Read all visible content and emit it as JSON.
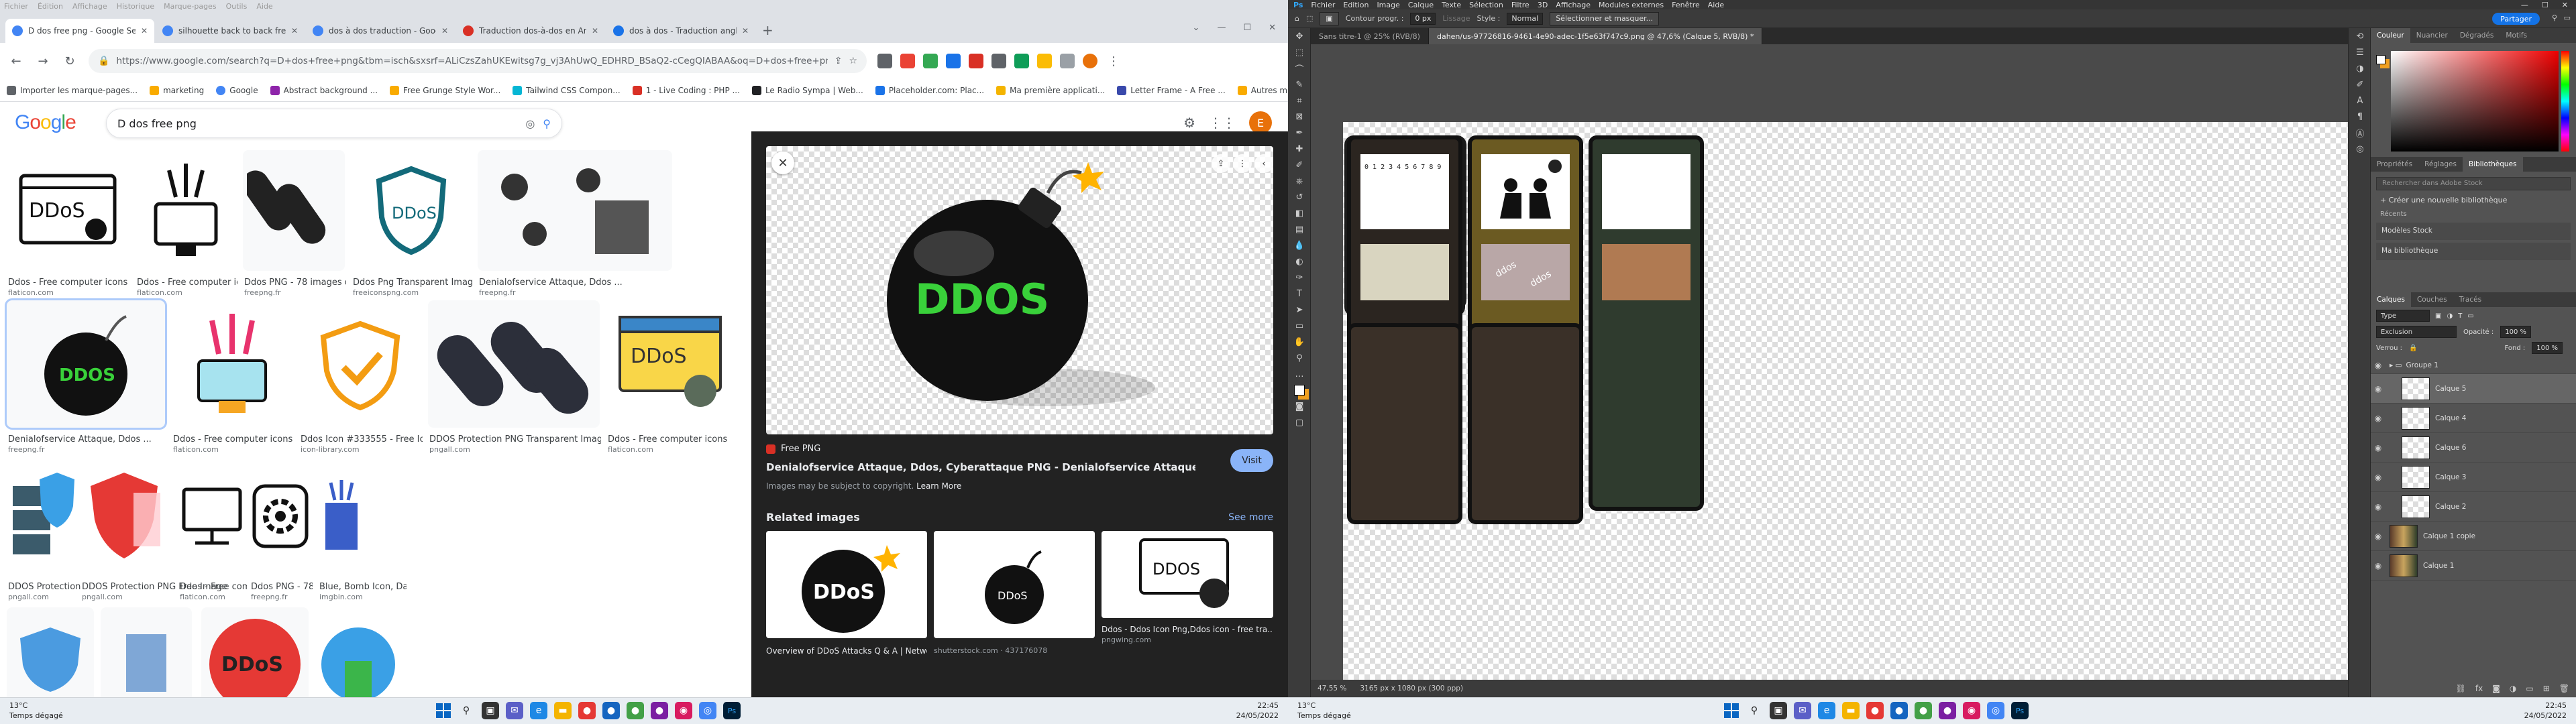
{
  "left": {
    "menu": [
      "Fichier",
      "Édition",
      "Affichage",
      "Historique",
      "Marque-pages",
      "Outils",
      "Aide"
    ],
    "tabs": [
      {
        "title": "D dos free png - Google Search",
        "color": "#4285f4",
        "active": true
      },
      {
        "title": "silhouette back to back free - G",
        "color": "#4285f4",
        "active": false
      },
      {
        "title": "dos à dos traduction - Google - G",
        "color": "#4285f4",
        "active": false
      },
      {
        "title": "Traduction dos-à-dos en Anglais",
        "color": "#d93025",
        "active": false
      },
      {
        "title": "dos à dos - Traduction anglaise",
        "color": "#1a73e8",
        "active": false
      }
    ],
    "new_tab": "+",
    "url": "https://www.google.com/search?q=D+dos+free+png&tbm=isch&sxsrf=ALiCzsZahUKEwitsg7g_vj3AhUwQ_EDHRD_BSaQ2-cCegQIABAA&oq=D+dos+free+png&gs_lcp=CgNpbWcQAzoECCMQJ",
    "bookmarks": [
      {
        "label": "Importer les marque-pages...",
        "color": "#5f6368"
      },
      {
        "label": "marketing",
        "color": "#f9ab00"
      },
      {
        "label": "Google",
        "color": "#4285f4"
      },
      {
        "label": "Abstract background ...",
        "color": "#8e24aa"
      },
      {
        "label": "Free Grunge Style Wor...",
        "color": "#f9ab00"
      },
      {
        "label": "Tailwind CSS Compon...",
        "color": "#06b6d4"
      },
      {
        "label": "1 - Live Coding : PHP ...",
        "color": "#d93025"
      },
      {
        "label": "Le Radio Sympa | Web...",
        "color": "#202124"
      },
      {
        "label": "Placeholder.com: Plac...",
        "color": "#1a73e8"
      },
      {
        "label": "Ma première applicati...",
        "color": "#f4b400"
      },
      {
        "label": "Letter Frame - A Free ...",
        "color": "#3949ab"
      }
    ],
    "bookmarks_more": "Autres marque-pages",
    "google_logo": [
      {
        "ch": "G",
        "color": "#4285f4"
      },
      {
        "ch": "o",
        "color": "#ea4335"
      },
      {
        "ch": "o",
        "color": "#fbbc05"
      },
      {
        "ch": "g",
        "color": "#4285f4"
      },
      {
        "ch": "l",
        "color": "#34a853"
      },
      {
        "ch": "e",
        "color": "#ea4335"
      }
    ],
    "search_query": "D dos free png",
    "avatar_letter": "E",
    "results": [
      {
        "caption": "Ddos - Free computer icons",
        "source": "flaticon.com"
      },
      {
        "caption": "Ddos - Free computer icons",
        "source": "flaticon.com"
      },
      {
        "caption": "Ddos PNG - 78 images de Dd...",
        "source": "freepng.fr"
      },
      {
        "caption": "Ddos Png Transparent Image...",
        "source": "freeiconspng.com"
      },
      {
        "caption": "Denialofservice Attaque, Ddos ...",
        "source": "freepng.fr"
      },
      {
        "caption": "Denialofservice Attaque, Ddos ...",
        "source": "freepng.fr"
      },
      {
        "caption": "Ddos - Free computer icons",
        "source": "flaticon.com"
      },
      {
        "caption": "Ddos Icon #333555 - Free Ico...",
        "source": "icon-library.com"
      },
      {
        "caption": "DDOS Protection PNG Transparent Imag...",
        "source": "pngall.com"
      },
      {
        "caption": "Ddos - Free computer icons",
        "source": "flaticon.com"
      },
      {
        "caption": "DDOS Protection PNG Transpare...",
        "source": "pngall.com"
      },
      {
        "caption": "DDOS Protection PNG Free Image | PNG All",
        "source": "pngall.com"
      },
      {
        "caption": "Ddos - Free computer icons",
        "source": "flaticon.com"
      },
      {
        "caption": "Ddos PNG - 78 images de Ddo...",
        "source": "freepng.fr"
      },
      {
        "caption": "Blue, Bomb Icon, Data Pr...",
        "source": "imgbin.com"
      }
    ],
    "ddos_text": "DDoS",
    "ddos_upper": "DDOS",
    "preview": {
      "source": "Free PNG",
      "title": "Denialofservice Attaque, Ddos, Cyberattaque PNG - Denialofservice Attaque, Ddos, Cyberattaque...",
      "visit": "Visit",
      "copyright": "Images may be subject to copyright.",
      "learn_more": "Learn More",
      "related_heading": "Related images",
      "see_more": "See more",
      "related": [
        {
          "caption": "Overview of DDoS Attacks Q & A | Network...",
          "source": ""
        },
        {
          "caption": "",
          "source": "shutterstock.com · 437176078"
        },
        {
          "caption": "Ddos - Ddos Icon Png,Ddos icon - free tra...",
          "source": "pngwing.com"
        }
      ],
      "related_labels": [
        "DDoS",
        "DDoS",
        "DDOS"
      ]
    },
    "taskbar": {
      "temp": "13°C",
      "weather": "Temps dégagé",
      "time": "22:45",
      "date": "24/05/2022"
    }
  },
  "right": {
    "menu": [
      "Fichier",
      "Edition",
      "Image",
      "Calque",
      "Texte",
      "Sélection",
      "Filtre",
      "3D",
      "Affichage",
      "Modules externes",
      "Fenêtre",
      "Aide"
    ],
    "options": {
      "feather_label": "Contour progr. :",
      "feather": "0 px",
      "smooth": "Lissage",
      "style_label": "Style :",
      "style": "Normal",
      "select_mask": "Sélectionner et masquer...",
      "share": "Partager"
    },
    "doc_tabs": [
      "Sans titre-1 @ 25% (RVB/8)",
      "dahen/us-97726816-9461-4e90-adec-1f5e63f747c9.png @ 47,6% (Calque 5, RVB/8) *"
    ],
    "status": {
      "zoom": "47,55 %",
      "doc": "3165 px x 1080 px (300 ppp)"
    },
    "color_tabs": [
      "Couleur",
      "Nuancier",
      "Dégradés",
      "Motifs"
    ],
    "props_tabs": [
      "Propriétés",
      "Réglages",
      "Bibliothèques"
    ],
    "library": {
      "search": "Rechercher dans Adobe Stock",
      "new": "Créer une nouvelle bibliothèque",
      "recent": "Récents",
      "items": [
        "Modèles Stock",
        "Ma bibliothèque"
      ]
    },
    "layer_tabs": [
      "Calques",
      "Couches",
      "Tracés"
    ],
    "layer_controls": {
      "kind": "Type",
      "blend": "Exclusion",
      "opacity_label": "Opacité :",
      "opacity": "100 %",
      "lock_label": "Verrou :",
      "fill_label": "Fond :",
      "fill": "100 %"
    },
    "layers": [
      {
        "name": "Groupe 1",
        "kind": "group",
        "active": false
      },
      {
        "name": "Calque 5",
        "kind": "layer",
        "active": true
      },
      {
        "name": "Calque 4",
        "kind": "layer",
        "active": false
      },
      {
        "name": "Calque 6",
        "kind": "layer",
        "active": false
      },
      {
        "name": "Calque 3",
        "kind": "layer",
        "active": false
      },
      {
        "name": "Calque 2",
        "kind": "layer",
        "active": false
      },
      {
        "name": "Calque 1 copie",
        "kind": "layer",
        "active": false
      },
      {
        "name": "Calque 1",
        "kind": "layer",
        "active": false
      }
    ],
    "card_symbols": "0 1 2 3 4 5 6 7 8 9",
    "card_art_labels": [
      "ddos",
      "ddos"
    ],
    "ddos_text": "DDOS",
    "taskbar": {
      "temp": "13°C",
      "weather": "Temps dégagé",
      "time": "22:45",
      "date": "24/05/2022"
    }
  }
}
